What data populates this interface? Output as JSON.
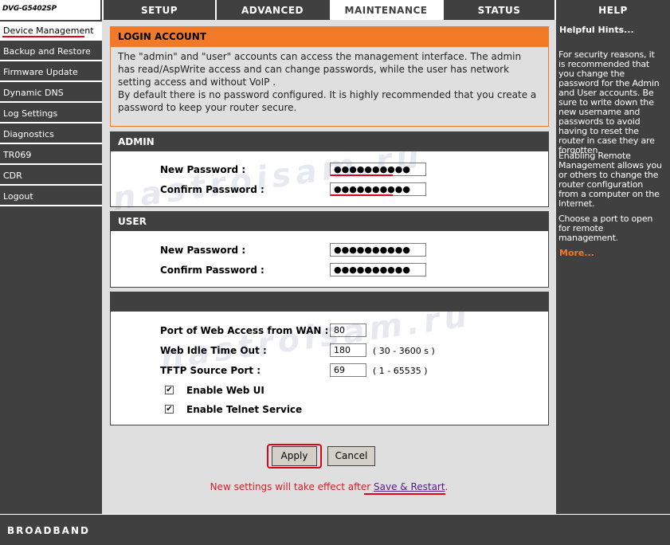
{
  "brand": {
    "model": "DVG-G5402SP",
    "footer": "BROADBAND"
  },
  "tabs": [
    {
      "label": "SETUP"
    },
    {
      "label": "ADVANCED"
    },
    {
      "label": "MAINTENANCE"
    },
    {
      "label": "STATUS"
    },
    {
      "label": "HELP"
    }
  ],
  "nav": [
    {
      "label": "Device Management"
    },
    {
      "label": "Backup and Restore"
    },
    {
      "label": "Firmware Update"
    },
    {
      "label": "Dynamic DNS"
    },
    {
      "label": "Log Settings"
    },
    {
      "label": "Diagnostics"
    },
    {
      "label": "TR069"
    },
    {
      "label": "CDR"
    },
    {
      "label": "Logout"
    }
  ],
  "login": {
    "title": "LOGIN ACCOUNT",
    "p1": "The \"admin\" and \"user\" accounts can access the management interface. The admin has read/AspWrite access and can change passwords, while the user has network setting access and without VoIP .",
    "p2": "By default there is no password configured. It is highly recommended that you create a password to keep your router secure."
  },
  "admin": {
    "title": "ADMIN",
    "new_label": "New Password :",
    "confirm_label": "Confirm Password :",
    "new_value": "●●●●●●●●●●",
    "confirm_value": "●●●●●●●●●●"
  },
  "user": {
    "title": "USER",
    "new_label": "New Password :",
    "confirm_label": "Confirm Password :",
    "new_value": "●●●●●●●●●●",
    "confirm_value": "●●●●●●●●●●"
  },
  "remote": {
    "title": "",
    "port_label": "Port of Web Access from WAN :",
    "port_value": "80",
    "idle_label": "Web Idle Time Out :",
    "idle_value": "180",
    "idle_hint": "( 30 - 3600 s )",
    "tftp_label": "TFTP Source Port :",
    "tftp_value": "69",
    "tftp_hint": "( 1 - 65535 )",
    "webui_label": "Enable Web UI",
    "webui_checked": "✔",
    "telnet_label": "Enable Telnet Service",
    "telnet_checked": "✔"
  },
  "buttons": {
    "apply": "Apply",
    "cancel": "Cancel"
  },
  "notice": {
    "text": "New settings will take effect after ",
    "link": "Save & Restart",
    "end": "."
  },
  "hints": {
    "title": "Helpful Hints...",
    "p1": "For security reasons, it is recommended that you change the password for the Admin and User accounts. Be sure to write down the new username and passwords to avoid having to reset the router in case they are forgotten.",
    "p2": "Enabling Remote Management allows you or others to change the router configuration from a computer on the Internet.",
    "p3": "Choose a port to open for remote management.",
    "more": "More..."
  },
  "watermark": "nastroisam.ru",
  "colors": {
    "accent": "#f27a27",
    "dark": "#404040",
    "highlight": "#e2001a"
  }
}
